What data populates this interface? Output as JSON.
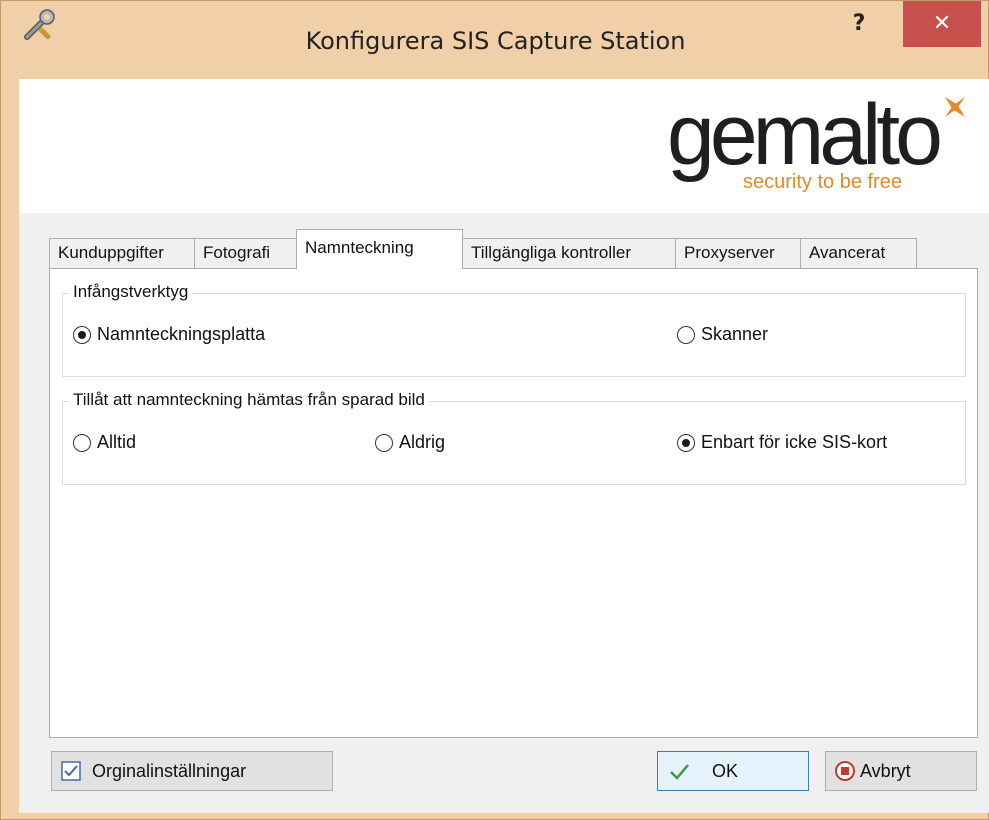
{
  "window": {
    "title": "Konfigurera SIS Capture Station",
    "help_label": "?",
    "close_label": "✕"
  },
  "logo": {
    "brand": "gemalto",
    "tagline": "security to be free"
  },
  "tabs": [
    {
      "label": "Kunduppgifter",
      "active": false
    },
    {
      "label": "Fotografi",
      "active": false
    },
    {
      "label": "Namnteckning",
      "active": true
    },
    {
      "label": "Tillgängliga kontroller",
      "active": false
    },
    {
      "label": "Proxyserver",
      "active": false
    },
    {
      "label": "Avancerat",
      "active": false
    }
  ],
  "capture_tool": {
    "title": "Infångstverktyg",
    "options": [
      {
        "label": "Namnteckningsplatta",
        "checked": true
      },
      {
        "label": "Skanner",
        "checked": false
      }
    ]
  },
  "saved_image": {
    "title": "Tillåt att namnteckning hämtas från sparad bild",
    "options": [
      {
        "label": "Alltid",
        "checked": false
      },
      {
        "label": "Aldrig",
        "checked": false
      },
      {
        "label": "Enbart för icke SIS-kort",
        "checked": true
      }
    ]
  },
  "buttons": {
    "defaults": "Orginalinställningar",
    "ok": "OK",
    "cancel": "Avbryt"
  },
  "colors": {
    "title_bar": "#f1d0a9",
    "close_button": "#c7504d",
    "brand_accent": "#e18a2a"
  }
}
